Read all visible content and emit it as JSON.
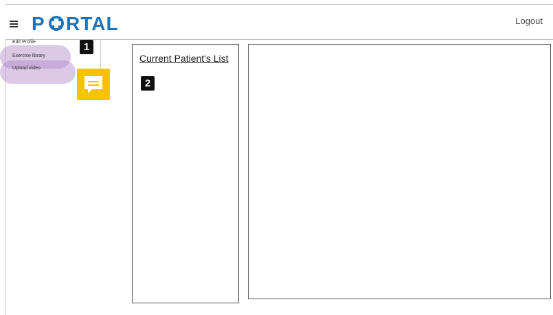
{
  "header": {
    "logo_text": "P+RTAL",
    "logout_label": "Logout"
  },
  "sidebar": {
    "items": [
      {
        "label": "Edit Profile"
      },
      {
        "label": "Exercise library"
      },
      {
        "label": "Upload video"
      }
    ]
  },
  "annotations": {
    "badge_1": "1",
    "badge_2": "2"
  },
  "patients_panel": {
    "title": "Current Patient's List"
  },
  "colors": {
    "brand": "#1d72b8",
    "highlight": "#af87c8",
    "comment": "#f5c400"
  }
}
